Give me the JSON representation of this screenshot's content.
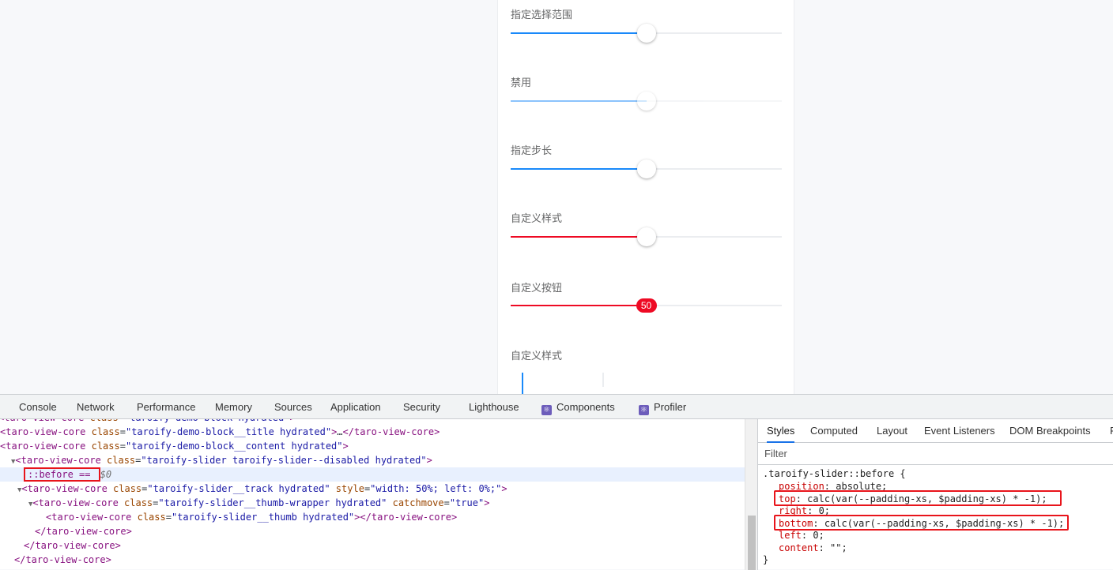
{
  "demos": [
    {
      "title": "指定选择范围",
      "value": 0.5,
      "disabled": false,
      "fill": "#1989fa",
      "thumb": "default"
    },
    {
      "title": "禁用",
      "value": 0.5,
      "disabled": true,
      "fill": "#1989fa",
      "thumb": "default"
    },
    {
      "title": "指定步长",
      "value": 0.5,
      "disabled": false,
      "fill": "#1989fa",
      "thumb": "default"
    },
    {
      "title": "自定义样式",
      "value": 0.5,
      "disabled": false,
      "fill": "#ee0a24",
      "thumb": "default"
    },
    {
      "title": "自定义按钮",
      "value": 0.5,
      "disabled": false,
      "fill": "#ee0a24",
      "thumb": "custom",
      "thumb_label": "50"
    },
    {
      "title": "自定义样式",
      "value": 0.5,
      "disabled": false,
      "fill": "#1989fa",
      "thumb": "vertical"
    }
  ],
  "devtools": {
    "tabs": [
      {
        "label": "Console"
      },
      {
        "label": "Network"
      },
      {
        "label": "Performance"
      },
      {
        "label": "Memory"
      },
      {
        "label": "Sources"
      },
      {
        "label": "Application"
      },
      {
        "label": "Security"
      },
      {
        "label": "Lighthouse"
      },
      {
        "label": "Components",
        "icon": "react-icon"
      },
      {
        "label": "Profiler",
        "icon": "react-icon"
      }
    ],
    "elements": [
      {
        "text": "<taro-view-core class=\"taroify-demo-block hydrated\">"
      },
      {
        "text": "<taro-view-core class=\"taroify-demo-block__title hydrated\">…</taro-view-core>"
      },
      {
        "text": "<taro-view-core class=\"taroify-demo-block__content hydrated\">"
      },
      {
        "text": "<taro-view-core class=\"taroify-slider taroify-slider--disabled hydrated\">"
      },
      {
        "text": "::before == ",
        "dollar": "$0",
        "selected": true
      },
      {
        "text": "<taro-view-core class=\"taroify-slider__track hydrated\" style=\"width: 50%; left: 0%;\">"
      },
      {
        "text": "<taro-view-core class=\"taroify-slider__thumb-wrapper hydrated\" catchmove=\"true\">"
      },
      {
        "text": "<taro-view-core class=\"taroify-slider__thumb hydrated\"></taro-view-core>"
      },
      {
        "text": "</taro-view-core>"
      },
      {
        "text": "</taro-view-core>"
      },
      {
        "text": "</taro-view-core>"
      }
    ],
    "styles_tabs": [
      "Styles",
      "Computed",
      "Layout",
      "Event Listeners",
      "DOM Breakpoints",
      "P"
    ],
    "filter_placeholder": "Filter",
    "css_rule": {
      "selector": ".taroify-slider::before {",
      "declarations": [
        {
          "prop": "position",
          "value": "absolute;"
        },
        {
          "prop": "top",
          "value": "calc(var(--padding-xs, $padding-xs) * -1);",
          "highlight": true
        },
        {
          "prop": "right",
          "value": "0;"
        },
        {
          "prop": "bottom",
          "value": "calc(var(--padding-xs, $padding-xs) * -1);",
          "highlight": true
        },
        {
          "prop": "left",
          "value": "0;"
        },
        {
          "prop": "content",
          "value": "\"\";"
        }
      ],
      "close": "}"
    }
  }
}
